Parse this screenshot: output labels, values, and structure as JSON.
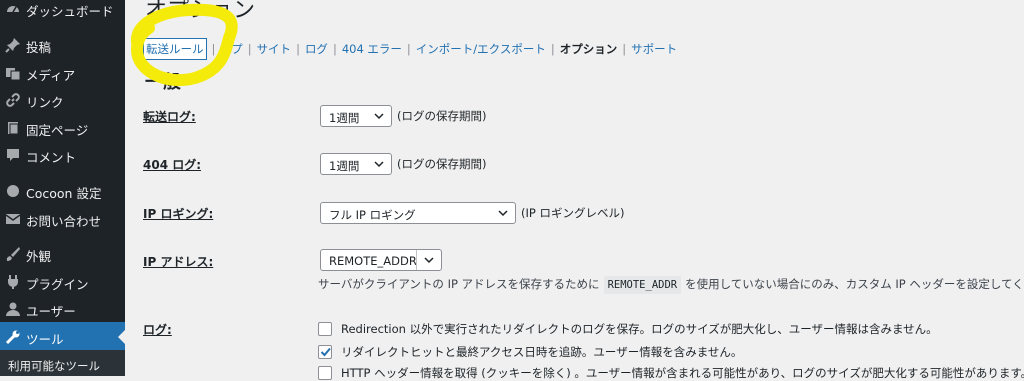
{
  "sidebar": {
    "items": [
      {
        "label": "ダッシュボード",
        "icon": "dashboard-icon"
      },
      {
        "label": "投稿",
        "icon": "pin-icon"
      },
      {
        "label": "メディア",
        "icon": "media-icon"
      },
      {
        "label": "リンク",
        "icon": "link-icon"
      },
      {
        "label": "固定ページ",
        "icon": "page-icon"
      },
      {
        "label": "コメント",
        "icon": "comment-icon"
      },
      {
        "label": "Cocoon 設定",
        "icon": "circle-icon"
      },
      {
        "label": "お問い合わせ",
        "icon": "mail-icon"
      },
      {
        "label": "外観",
        "icon": "brush-icon"
      },
      {
        "label": "プラグイン",
        "icon": "plugin-icon"
      },
      {
        "label": "ユーザー",
        "icon": "user-icon"
      },
      {
        "label": "ツール",
        "icon": "wrench-icon"
      }
    ],
    "submenu_label": "利用可能なツール"
  },
  "page": {
    "title": "オプション"
  },
  "tabs": {
    "items": [
      "転送ルール",
      "グループ",
      "サイト",
      "ログ",
      "404 エラー",
      "インポート/エクスポート",
      "オプション",
      "サポート"
    ],
    "visible": [
      "転送ルール",
      "ープ",
      "サイト",
      "ログ",
      "404 エラー",
      "インポート/エクスポート",
      "オプション",
      "サポート"
    ]
  },
  "section": {
    "heading": "一般"
  },
  "settings": {
    "redirect_log": {
      "label": "転送ログ:",
      "value": "1週間",
      "hint": "(ログの保存期間)"
    },
    "log_404": {
      "label": "404 ログ:",
      "value": "1週間",
      "hint": "(ログの保存期間)"
    },
    "ip_logging": {
      "label": "IP ロギング:",
      "value": "フル IP ロギング",
      "hint": "(IP ロギングレベル)"
    },
    "ip_address": {
      "label": "IP アドレス:",
      "value": "REMOTE_ADDR",
      "desc_before": "サーバがクライアントの IP アドレスを保存するために",
      "desc_code": "REMOTE_ADDR",
      "desc_after": "を使用していない場合にのみ、カスタム IP ヘッダーを設定してくださ"
    },
    "logs": {
      "label": "ログ:",
      "options": [
        {
          "text": "Redirection 以外で実行されたリダイレクトのログを保存。ログのサイズが肥大化し、ユーザー情報は含みません。",
          "checked": false
        },
        {
          "text": "リダイレクトヒットと最終アクセス日時を追跡。ユーザー情報を含みません。",
          "checked": true
        },
        {
          "text": "HTTP ヘッダー情報を取得 (クッキーを除く) 。ユーザー情報が含まれる可能性があり、ログのサイズが肥大化する可能性があります。",
          "checked": false
        }
      ]
    }
  },
  "colors": {
    "sidebar_bg": "#1d2327",
    "accent": "#2271b1",
    "highlight": "#f5eb0a"
  }
}
